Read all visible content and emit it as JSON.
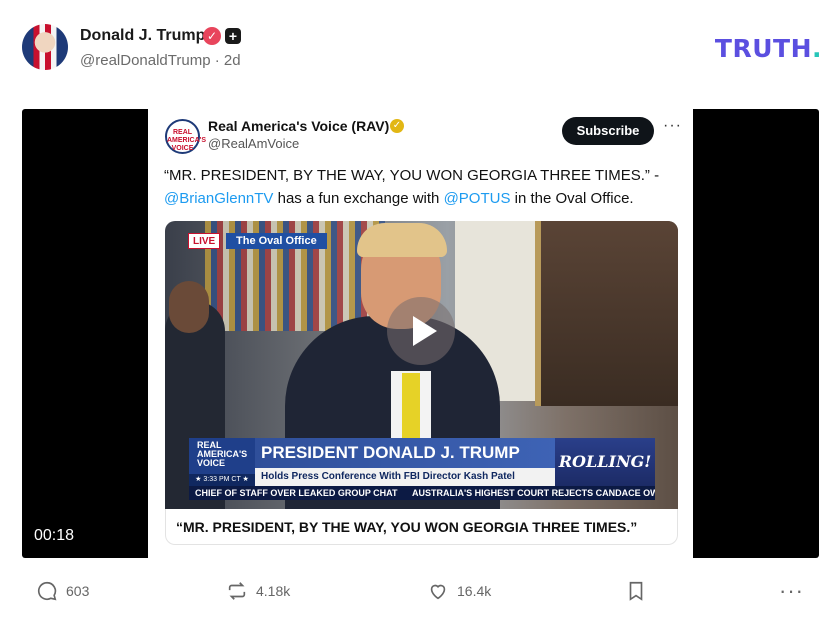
{
  "post": {
    "author_name": "Donald J. Trump",
    "handle_time": "@realDonaldTrump · 2d",
    "verified_icon": "verified-badge-icon",
    "plus_icon": "plus-badge-icon"
  },
  "brand": {
    "logo_text": "TRUTH",
    "logo_dot": ".",
    "logo_color": "#5b4fe0",
    "dot_color": "#27c6b8"
  },
  "embed": {
    "name": "Real America's Voice (RAV)",
    "handle": "@RealAmVoice",
    "subscribe_label": "Subscribe",
    "more_label": "···",
    "avatar_text": "REAL AMERICA'S VOICE",
    "text_quote": "“MR. PRESIDENT, BY THE WAY, YOU WON GEORGIA THREE TIMES.” -",
    "mention1": "@BrianGlennTV",
    "text_mid": " has a fun exchange with ",
    "mention2": "@POTUS",
    "text_end": " in the Oval Office.",
    "caption": "“MR. PRESIDENT, BY THE WAY, YOU WON GEORGIA THREE TIMES.”"
  },
  "video": {
    "live_label": "LIVE",
    "location_label": "The Oval Office",
    "rav_label": "REAL AMERICA'S VOICE",
    "time_label": "★ 3:33 PM CT ★",
    "headline": "PRESIDENT DONALD J. TRUMP",
    "subheadline": "Holds Press Conference With FBI Director Kash Patel",
    "show_logo": "ROLLING!",
    "ticker_left": "CHIEF OF STAFF OVER LEAKED GROUP CHAT",
    "ticker_right": "AUSTRALIA'S HIGHEST COURT REJECTS CANDACE OWENS'",
    "duration": "00:18"
  },
  "actions": {
    "replies": "603",
    "retruths": "4.18k",
    "likes": "16.4k",
    "more_label": "···"
  }
}
